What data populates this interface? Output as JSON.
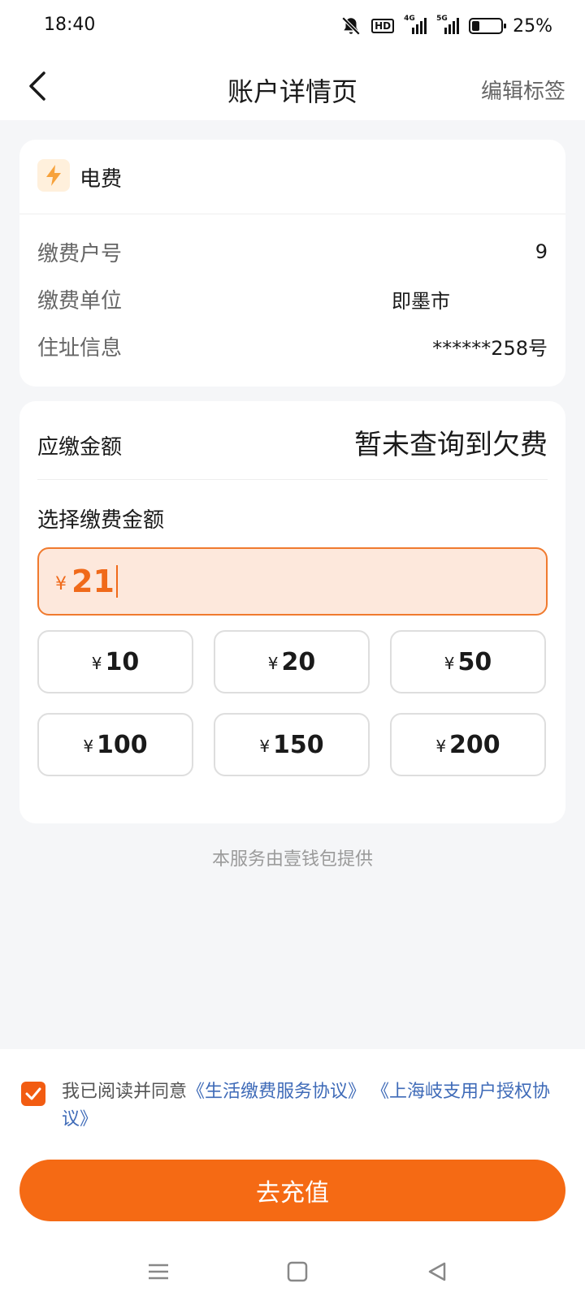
{
  "status_bar": {
    "time": "18:40",
    "hd_label": "HD",
    "net1_label": "4G",
    "net2_label": "5G",
    "battery_percent": "25%",
    "battery_level": 0.25
  },
  "header": {
    "title": "账户详情页",
    "action_label": "编辑标签",
    "back_icon": "chevron-left-icon"
  },
  "account_card": {
    "category_icon": "lightning-bolt-icon",
    "category": "电费",
    "rows": [
      {
        "label": "缴费户号",
        "value": "9"
      },
      {
        "label": "缴费单位",
        "value": "即墨市"
      },
      {
        "label": "住址信息",
        "value": "******258号"
      }
    ]
  },
  "payment_card": {
    "due_label": "应缴金额",
    "due_value": "暂未查询到欠费",
    "choose_label": "选择缴费金额",
    "currency": "¥",
    "input_value": "21",
    "options": [
      "10",
      "20",
      "50",
      "100",
      "150",
      "200"
    ]
  },
  "provider_note": "本服务由壹钱包提供",
  "agreement": {
    "prefix": "我已阅读并同意",
    "link1": "《生活缴费服务协议》",
    "link2": "《上海岐支用户授权协议》",
    "checked": true
  },
  "cta_label": "去充值",
  "colors": {
    "accent": "#f56a14",
    "input_bg": "#fde8dc",
    "link": "#3f6bb8"
  }
}
